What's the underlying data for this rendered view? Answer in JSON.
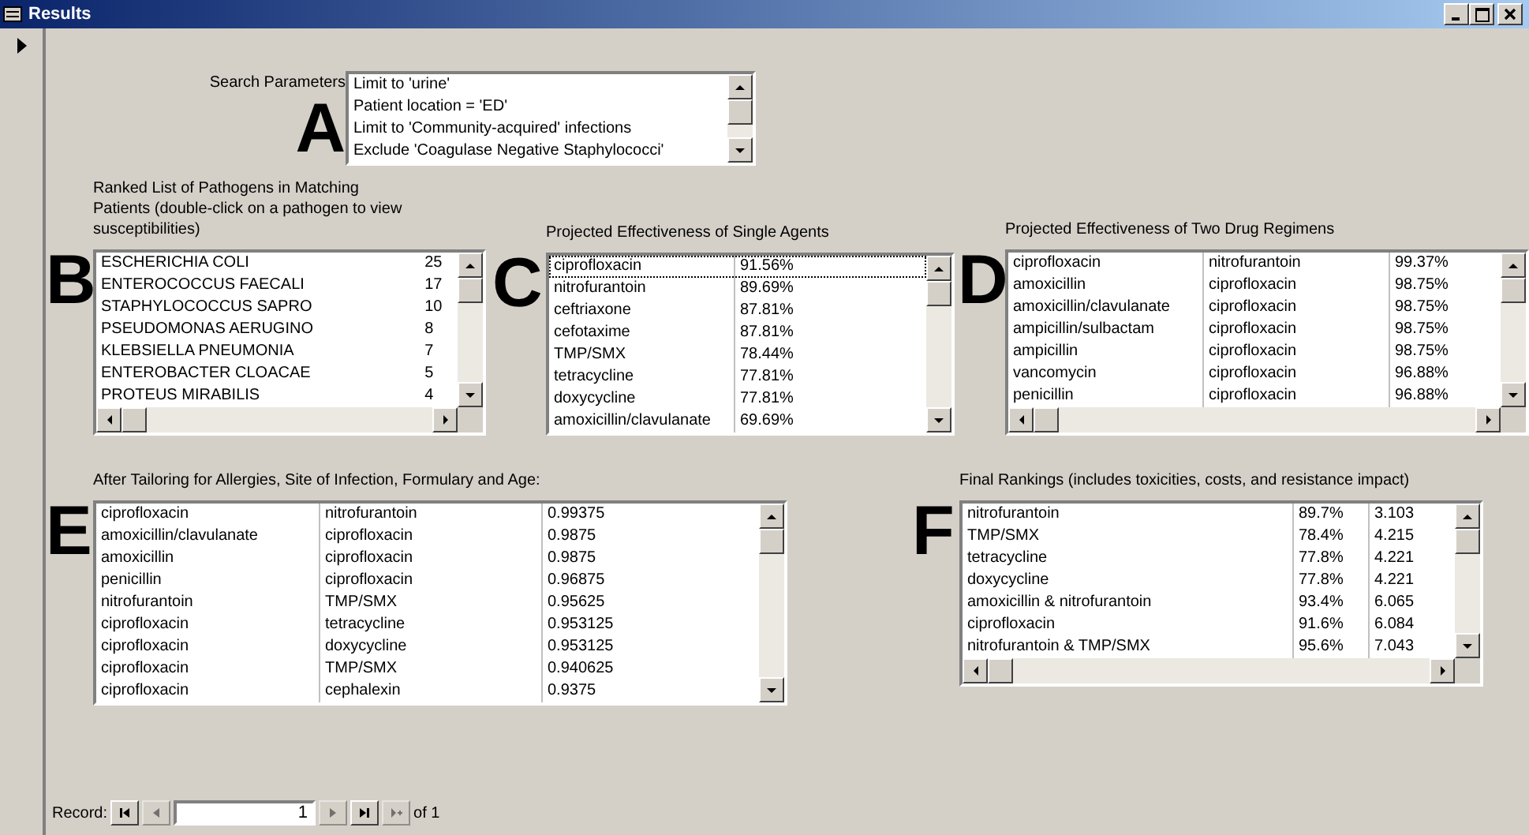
{
  "window": {
    "title": "Results"
  },
  "search_parameters": {
    "label": "Search Parameters",
    "letter": "A",
    "items": [
      "Limit to 'urine'",
      "Patient location = 'ED'",
      "Limit to 'Community-acquired' infections",
      "Exclude 'Coagulase Negative Staphylococci'"
    ]
  },
  "pathogens": {
    "caption": "Ranked List of Pathogens in Matching Patients (double-click on a pathogen to view susceptibilities)",
    "letter": "B",
    "rows": [
      {
        "cells": [
          "ESCHERICHIA COLI",
          "25"
        ]
      },
      {
        "cells": [
          "ENTEROCOCCUS FAECALI",
          "17"
        ]
      },
      {
        "cells": [
          "STAPHYLOCOCCUS SAPRO",
          "10"
        ]
      },
      {
        "cells": [
          "PSEUDOMONAS AERUGINO",
          "8"
        ]
      },
      {
        "cells": [
          "KLEBSIELLA PNEUMONIA",
          "7"
        ]
      },
      {
        "cells": [
          "ENTEROBACTER CLOACAE",
          "5"
        ]
      },
      {
        "cells": [
          "PROTEUS MIRABILIS",
          "4"
        ]
      }
    ]
  },
  "single_agents": {
    "caption": "Projected Effectiveness of Single Agents",
    "letter": "C",
    "rows": [
      {
        "cells": [
          "ciprofloxacin",
          "91.56%"
        ],
        "selected": true
      },
      {
        "cells": [
          "nitrofurantoin",
          "89.69%"
        ],
        "selected": false
      },
      {
        "cells": [
          "ceftriaxone",
          "87.81%"
        ],
        "selected": false
      },
      {
        "cells": [
          "cefotaxime",
          "87.81%"
        ],
        "selected": false
      },
      {
        "cells": [
          "TMP/SMX",
          "78.44%"
        ],
        "selected": false
      },
      {
        "cells": [
          "tetracycline",
          "77.81%"
        ],
        "selected": false
      },
      {
        "cells": [
          "doxycycline",
          "77.81%"
        ],
        "selected": false
      },
      {
        "cells": [
          "amoxicillin/clavulanate",
          "69.69%"
        ],
        "selected": false
      }
    ]
  },
  "two_drug_regimens": {
    "caption": "Projected Effectiveness of Two Drug Regimens",
    "letter": "D",
    "rows": [
      {
        "cells": [
          "ciprofloxacin",
          "nitrofurantoin",
          "99.37%"
        ]
      },
      {
        "cells": [
          "amoxicillin",
          "ciprofloxacin",
          "98.75%"
        ]
      },
      {
        "cells": [
          "amoxicillin/clavulanate",
          "ciprofloxacin",
          "98.75%"
        ]
      },
      {
        "cells": [
          "ampicillin/sulbactam",
          "ciprofloxacin",
          "98.75%"
        ]
      },
      {
        "cells": [
          "ampicillin",
          "ciprofloxacin",
          "98.75%"
        ]
      },
      {
        "cells": [
          "vancomycin",
          "ciprofloxacin",
          "96.88%"
        ]
      },
      {
        "cells": [
          "penicillin",
          "ciprofloxacin",
          "96.88%"
        ]
      }
    ]
  },
  "tailored": {
    "caption": "After Tailoring for Allergies, Site of Infection, Formulary and Age:",
    "letter": "E",
    "rows": [
      {
        "cells": [
          "ciprofloxacin",
          "nitrofurantoin",
          "0.99375"
        ]
      },
      {
        "cells": [
          "amoxicillin/clavulanate",
          "ciprofloxacin",
          "0.9875"
        ]
      },
      {
        "cells": [
          "amoxicillin",
          "ciprofloxacin",
          "0.9875"
        ]
      },
      {
        "cells": [
          "penicillin",
          "ciprofloxacin",
          "0.96875"
        ]
      },
      {
        "cells": [
          "nitrofurantoin",
          "TMP/SMX",
          "0.95625"
        ]
      },
      {
        "cells": [
          "ciprofloxacin",
          "tetracycline",
          "0.953125"
        ]
      },
      {
        "cells": [
          "ciprofloxacin",
          "doxycycline",
          "0.953125"
        ]
      },
      {
        "cells": [
          "ciprofloxacin",
          "TMP/SMX",
          "0.940625"
        ]
      },
      {
        "cells": [
          "ciprofloxacin",
          "cephalexin",
          "0.9375"
        ]
      }
    ]
  },
  "final_rankings": {
    "caption": "Final Rankings (includes toxicities, costs, and resistance impact)",
    "letter": "F",
    "rows": [
      {
        "cells": [
          "nitrofurantoin",
          "89.7%",
          "3.103"
        ]
      },
      {
        "cells": [
          "TMP/SMX",
          "78.4%",
          "4.215"
        ]
      },
      {
        "cells": [
          "tetracycline",
          "77.8%",
          "4.221"
        ]
      },
      {
        "cells": [
          "doxycycline",
          "77.8%",
          "4.221"
        ]
      },
      {
        "cells": [
          "amoxicillin & nitrofurantoin",
          "93.4%",
          "6.065"
        ]
      },
      {
        "cells": [
          "ciprofloxacin",
          "91.6%",
          "6.084"
        ]
      },
      {
        "cells": [
          "nitrofurantoin & TMP/SMX",
          "95.6%",
          "7.043"
        ]
      }
    ]
  },
  "record_navigator": {
    "label": "Record:",
    "current": "1",
    "total": "of 1",
    "buttons": [
      {
        "kind": "first",
        "disabled": false
      },
      {
        "kind": "previous",
        "disabled": true
      },
      {
        "kind": "next",
        "disabled": true
      },
      {
        "kind": "last",
        "disabled": false
      },
      {
        "kind": "new",
        "disabled": true
      }
    ]
  }
}
